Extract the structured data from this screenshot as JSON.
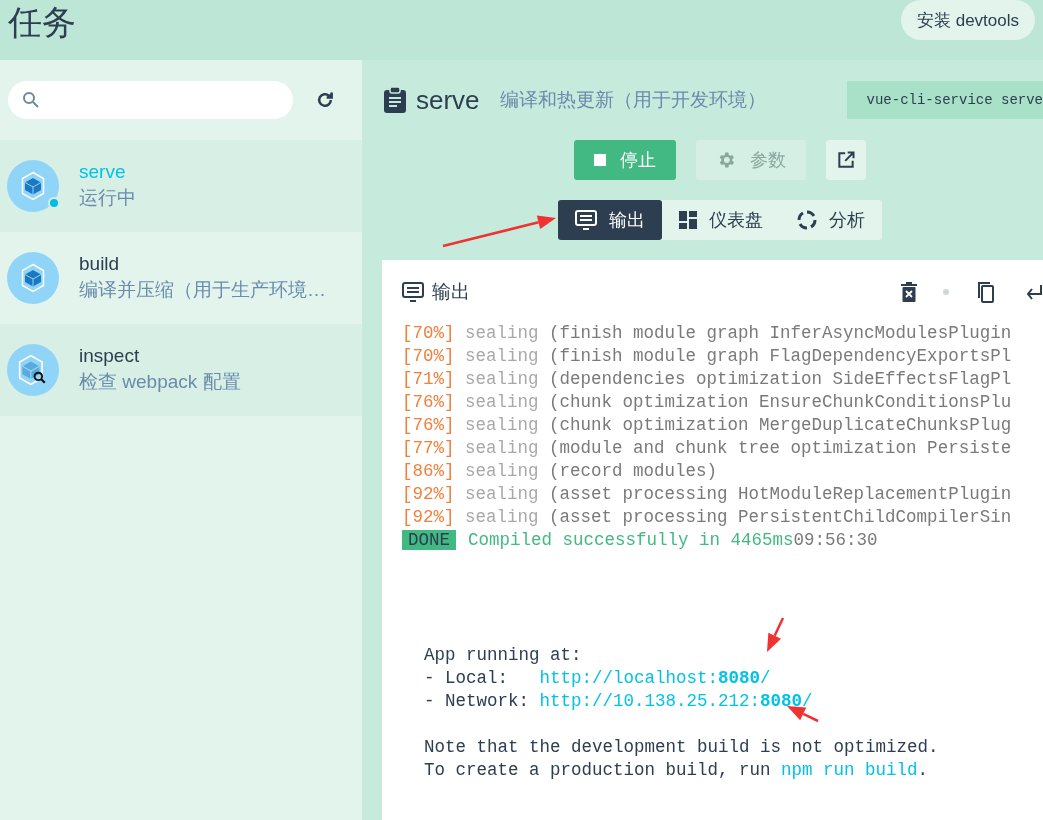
{
  "header": {
    "title": "任务",
    "install_button": "安装 devtools"
  },
  "sidebar": {
    "items": [
      {
        "name": "serve",
        "description": "运行中",
        "kind": "webpack",
        "selected": true,
        "running": true
      },
      {
        "name": "build",
        "description": "编译并压缩（用于生产环境…",
        "kind": "webpack",
        "selected": false,
        "running": false
      },
      {
        "name": "inspect",
        "description": "检查 webpack 配置",
        "kind": "inspect",
        "selected": false,
        "running": false
      }
    ]
  },
  "task": {
    "name": "serve",
    "description": "编译和热更新（用于开发环境）",
    "command": "vue-cli-service serve",
    "buttons": [
      {
        "kind": "stop",
        "label": "停止",
        "disabled": false
      },
      {
        "kind": "settings",
        "label": "参数",
        "disabled": true
      },
      {
        "kind": "open",
        "disabled": false
      }
    ],
    "tabs": [
      {
        "label": "输出",
        "kind": "monitor",
        "selected": true
      },
      {
        "label": "仪表盘",
        "kind": "dashboard",
        "selected": false
      },
      {
        "label": "分析",
        "kind": "ring",
        "selected": false
      }
    ]
  },
  "output": {
    "title": "输出",
    "log": [
      {
        "percent": "[70%]",
        "stage": "sealing",
        "message": "(finish module graph InferAsyncModulesPlugin"
      },
      {
        "percent": "[70%]",
        "stage": "sealing",
        "message": "(finish module graph FlagDependencyExportsPl"
      },
      {
        "percent": "[71%]",
        "stage": "sealing",
        "message": "(dependencies optimization SideEffectsFlagPl"
      },
      {
        "percent": "[76%]",
        "stage": "sealing",
        "message": "(chunk optimization EnsureChunkConditionsPlu"
      },
      {
        "percent": "[76%]",
        "stage": "sealing",
        "message": "(chunk optimization MergeDuplicateChunksPlug"
      },
      {
        "percent": "[77%]",
        "stage": "sealing",
        "message": "(module and chunk tree optimization Persiste"
      },
      {
        "percent": "[86%]",
        "stage": "sealing",
        "message": "(record modules)"
      },
      {
        "percent": "[92%]",
        "stage": "sealing",
        "message": "(asset processing HotModuleReplacementPlugin"
      },
      {
        "percent": "[92%]",
        "stage": "sealing",
        "message": "(asset processing PersistentChildCompilerSin"
      }
    ],
    "done": {
      "badge": "DONE",
      "message": "Compiled successfully in 4465ms",
      "time": "09:56:30"
    },
    "running_heading": "App running at:",
    "urls": [
      {
        "label": "- Local:   ",
        "url": "http://localhost:**8080**/"
      },
      {
        "label": "- Network: ",
        "url": "http://10.138.25.212:**8080**/"
      }
    ],
    "note": "Note that the development build is not optimized.",
    "hint": {
      "text": "To create a production build, run ",
      "command": "npm run build",
      "end": "."
    }
  }
}
